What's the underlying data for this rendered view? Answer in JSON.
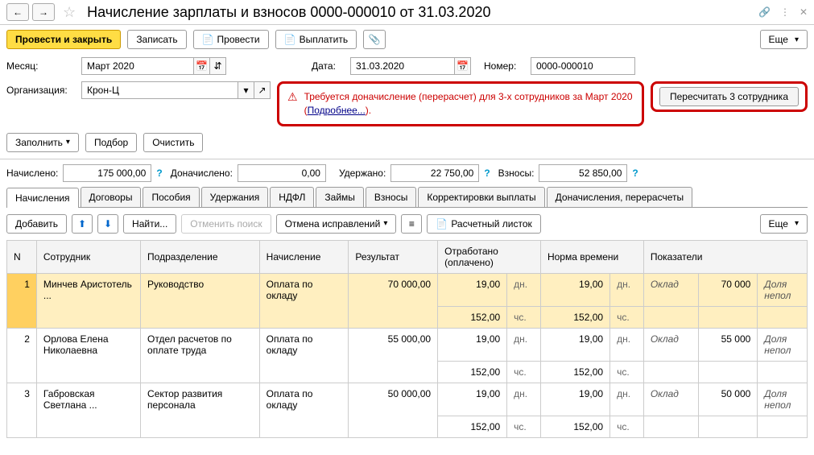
{
  "title": "Начисление зарплаты и взносов 0000-000010 от 31.03.2020",
  "nav": {
    "back": "←",
    "fwd": "→"
  },
  "toolbar": {
    "post_close": "Провести и закрыть",
    "save": "Записать",
    "post": "Провести",
    "pay": "Выплатить",
    "more": "Еще"
  },
  "form": {
    "month_label": "Месяц:",
    "month_value": "Март 2020",
    "date_label": "Дата:",
    "date_value": "31.03.2020",
    "number_label": "Номер:",
    "number_value": "0000-000010",
    "org_label": "Организация:",
    "org_value": "Крон-Ц"
  },
  "warning": {
    "text1": "Требуется доначисление (перерасчет) для 3-х сотрудников за Март 2020 (",
    "link": "Подробнее...",
    "text2": ").",
    "recalc_btn": "Пересчитать 3 сотрудника"
  },
  "fill": {
    "fill": "Заполнить",
    "select": "Подбор",
    "clear": "Очистить"
  },
  "totals": {
    "accrued_label": "Начислено:",
    "accrued_value": "175 000,00",
    "added_label": "Доначислено:",
    "added_value": "0,00",
    "withheld_label": "Удержано:",
    "withheld_value": "22 750,00",
    "contrib_label": "Взносы:",
    "contrib_value": "52 850,00"
  },
  "tabs": [
    "Начисления",
    "Договоры",
    "Пособия",
    "Удержания",
    "НДФЛ",
    "Займы",
    "Взносы",
    "Корректировки выплаты",
    "Доначисления, перерасчеты"
  ],
  "tab_tb": {
    "add": "Добавить",
    "find": "Найти...",
    "cancel_find": "Отменить поиск",
    "cancel_fix": "Отмена исправлений",
    "payslip": "Расчетный листок",
    "more": "Еще"
  },
  "grid": {
    "headers": [
      "N",
      "Сотрудник",
      "Подразделение",
      "Начисление",
      "Результат",
      "Отработано (оплачено)",
      "Норма времени",
      "Показатели"
    ],
    "units": {
      "days": "дн.",
      "hours": "чс."
    },
    "ind_label": "Оклад",
    "ind_extra": "Доля непол",
    "rows": [
      {
        "n": "1",
        "emp": "Минчев Аристотель ...",
        "dept": "Руководство",
        "accr": "Оплата по окладу",
        "result": "70 000,00",
        "wd": "19,00",
        "wh": "152,00",
        "nd": "19,00",
        "nh": "152,00",
        "ind": "70 000"
      },
      {
        "n": "2",
        "emp": "Орлова Елена Николаевна",
        "dept": "Отдел расчетов по оплате труда",
        "accr": "Оплата по окладу",
        "result": "55 000,00",
        "wd": "19,00",
        "wh": "152,00",
        "nd": "19,00",
        "nh": "152,00",
        "ind": "55 000"
      },
      {
        "n": "3",
        "emp": "Габровская Светлана ...",
        "dept": "Сектор развития персонала",
        "accr": "Оплата по окладу",
        "result": "50 000,00",
        "wd": "19,00",
        "wh": "152,00",
        "nd": "19,00",
        "nh": "152,00",
        "ind": "50 000"
      }
    ]
  }
}
